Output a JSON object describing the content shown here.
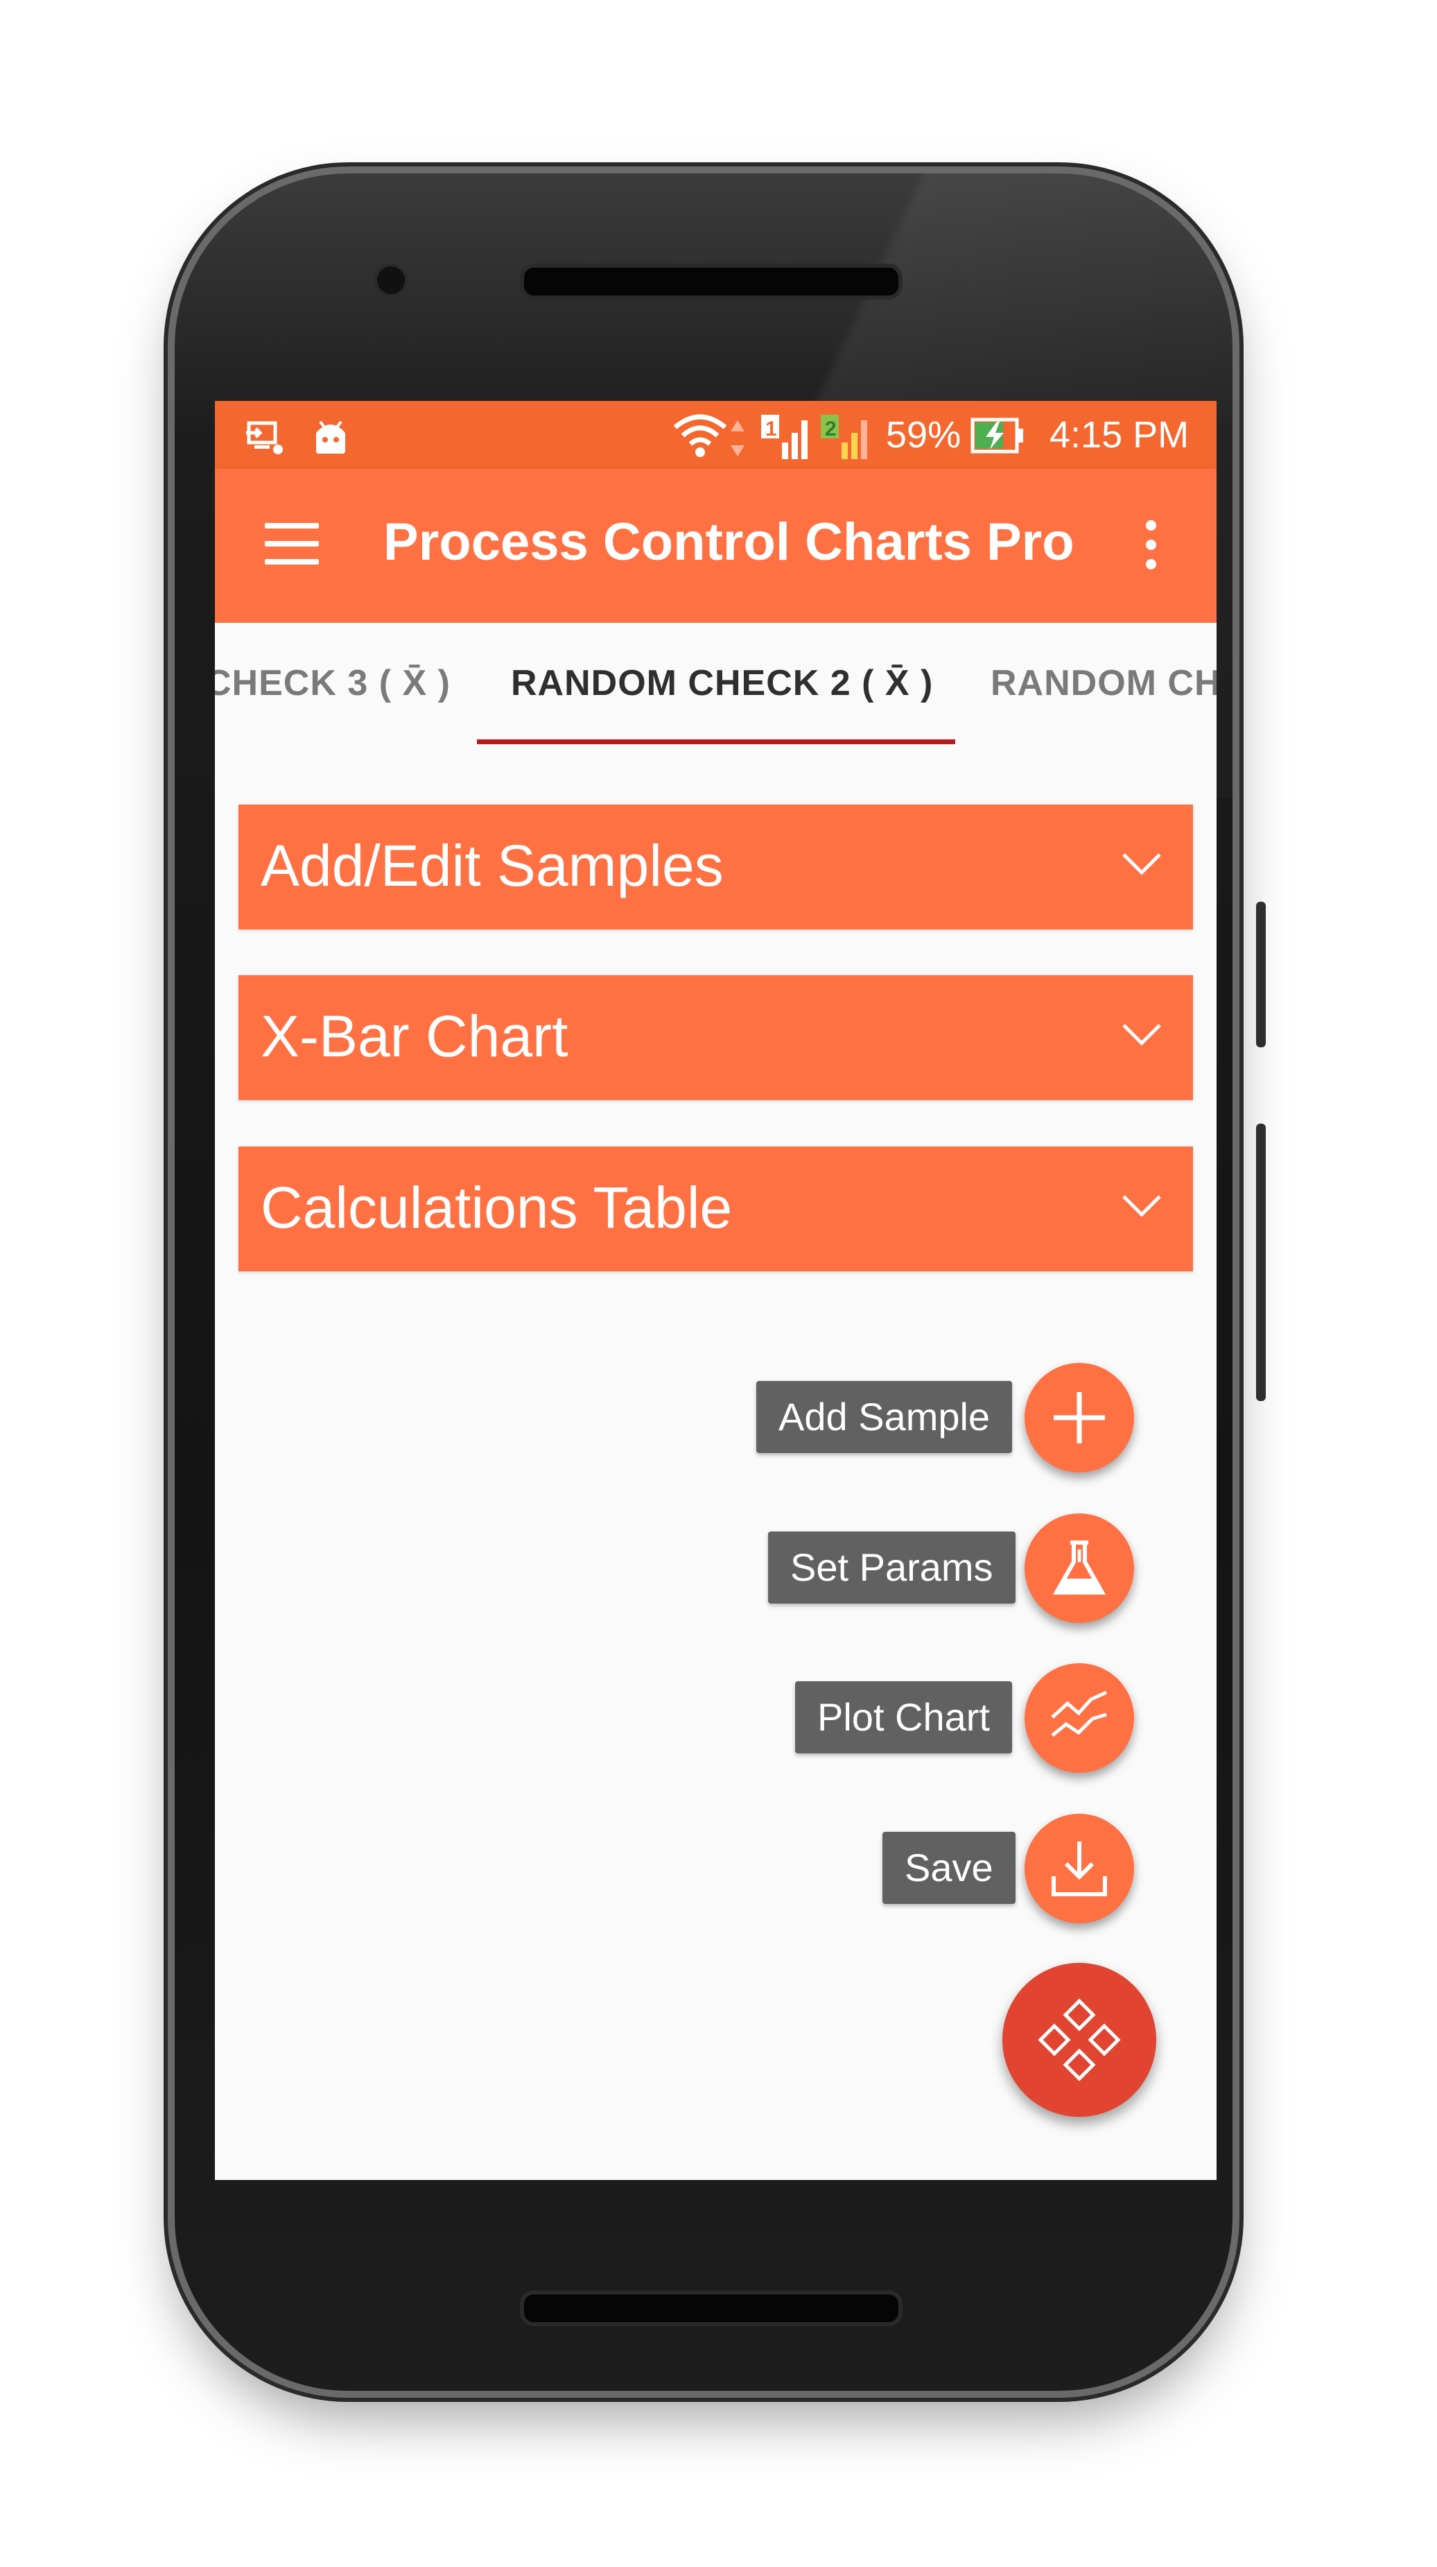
{
  "status_bar": {
    "left_icons": [
      "screen-cast-icon",
      "android-debug-icon"
    ],
    "right_icons": [
      "wifi-icon",
      "data-arrows-icon",
      "sim1-signal-icon",
      "sim2-signal-icon",
      "battery-charging-icon"
    ],
    "battery_percent": "59%",
    "time": "4:15 PM",
    "sim1_badge": "1",
    "sim2_badge": "2"
  },
  "app_bar": {
    "title": "Process Control Charts Pro",
    "menu_icon": "hamburger-menu-icon",
    "overflow_icon": "more-vert-icon"
  },
  "tabs": [
    {
      "label": "CHECK 3 ( X̄ )",
      "active": false
    },
    {
      "label": "RANDOM CHECK 2 ( X̄ )",
      "active": true
    },
    {
      "label": "RANDOM CH",
      "active": false
    }
  ],
  "panels": [
    {
      "title": "Add/Edit Samples",
      "icon": "chevron-down-icon"
    },
    {
      "title": "X-Bar Chart",
      "icon": "chevron-down-icon"
    },
    {
      "title": "Calculations Table",
      "icon": "chevron-down-icon"
    }
  ],
  "fab_menu": {
    "items": [
      {
        "label": "Add Sample",
        "icon": "plus-icon"
      },
      {
        "label": "Set Params",
        "icon": "flask-icon"
      },
      {
        "label": "Plot Chart",
        "icon": "line-chart-icon"
      },
      {
        "label": "Save",
        "icon": "download-icon"
      }
    ],
    "main_icon": "diamonds-icon"
  },
  "colors": {
    "status_bar": "#f4672f",
    "primary": "#ff7043",
    "accent": "#e14431",
    "tab_indicator": "#b71c1c",
    "label_bg": "#616161"
  }
}
